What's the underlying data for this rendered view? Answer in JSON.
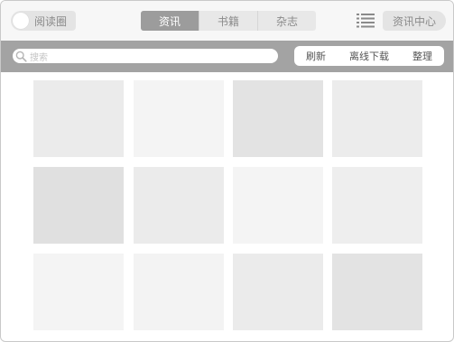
{
  "topbar": {
    "reading_circle_label": "阅读圈",
    "tabs": [
      {
        "label": "资讯",
        "active": true
      },
      {
        "label": "书籍",
        "active": false
      },
      {
        "label": "杂志",
        "active": false
      }
    ],
    "info_center_label": "资讯中心"
  },
  "search": {
    "placeholder": "搜索"
  },
  "actions": {
    "refresh": "刷新",
    "offline_download": "离线下载",
    "organize": "整理"
  },
  "tiles": [
    {
      "color": "#ebebeb"
    },
    {
      "color": "#f4f4f4"
    },
    {
      "color": "#e3e3e3"
    },
    {
      "color": "#ececec"
    },
    {
      "color": "#e0e0e0"
    },
    {
      "color": "#ebebeb"
    },
    {
      "color": "#f4f4f4"
    },
    {
      "color": "#eeeeee"
    },
    {
      "color": "#f4f4f4"
    },
    {
      "color": "#f3f3f3"
    },
    {
      "color": "#ebebeb"
    },
    {
      "color": "#e3e3e3"
    }
  ]
}
